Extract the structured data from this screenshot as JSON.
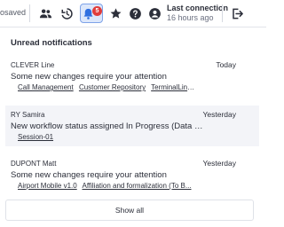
{
  "topbar": {
    "saved_text": "osaved",
    "last_connection_label": "Last connection",
    "last_connection_value": "16 hours ago",
    "notification_count": "5",
    "accent_color": "#2f6fe0",
    "badge_color": "#e03c3c",
    "icons": [
      "users-icon",
      "history-icon",
      "bell-icon",
      "star-icon",
      "help-icon",
      "user-circle-icon",
      "logout-icon"
    ]
  },
  "panel": {
    "header": "Unread notifications",
    "show_all_label": "Show all",
    "notifications": [
      {
        "author": "CLEVER Line",
        "date": "Today",
        "message": "Some new changes require your attention",
        "links": [
          "Call Management",
          "Customer Repository",
          "TerminalLin..."
        ]
      },
      {
        "author": "RY Samira",
        "date": "Yesterday",
        "message": "New workflow status assigned In Progress (Data Cal...",
        "links": [
          "Session-01"
        ]
      },
      {
        "author": "DUPONT Matt",
        "date": "Yesterday",
        "message": "Some new changes require your attention",
        "links": [
          "Airport Mobile v1.0",
          "Affiliation and formalization (To B..."
        ]
      }
    ]
  }
}
